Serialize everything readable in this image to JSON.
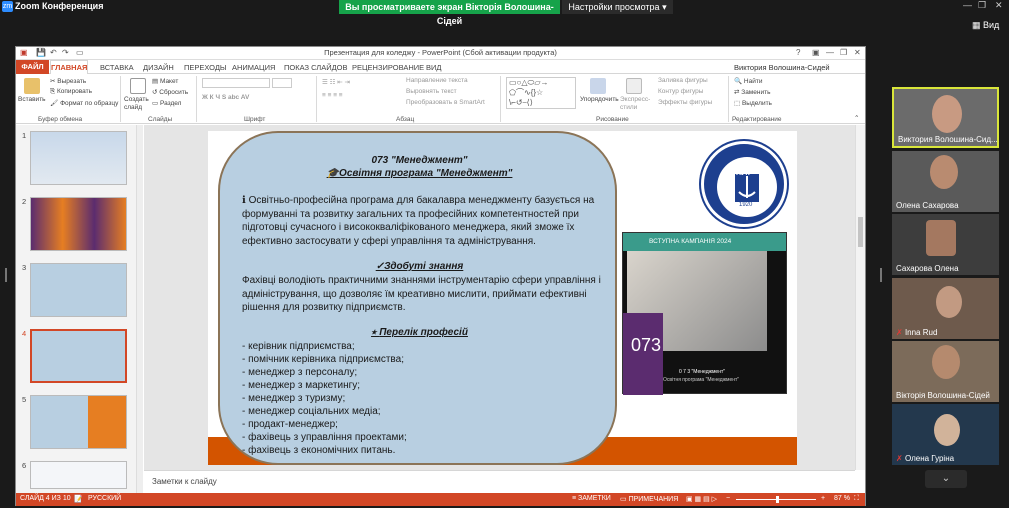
{
  "zoom": {
    "app_title": "Zoom Конференция",
    "share_banner": "Вы просматриваете экран Вікторія Волошина-Сідей",
    "view_options": "Настройки просмотра",
    "view_button": "Вид"
  },
  "ppt": {
    "window_title": "Презентация для коледжу - PowerPoint (Сбой активации продукта)",
    "user_name": "Виктория Волошина-Сидей",
    "tabs": [
      "ФАЙЛ",
      "ГЛАВНАЯ",
      "ВСТАВКА",
      "ДИЗАЙН",
      "ПЕРЕХОДЫ",
      "АНИМАЦИЯ",
      "ПОКАЗ СЛАЙДОВ",
      "РЕЦЕНЗИРОВАНИЕ",
      "ВИД"
    ],
    "ribbon": {
      "paste": "Вставить",
      "cut": "Вырезать",
      "copy": "Копировать",
      "format_painter": "Формат по образцу",
      "group_clipboard": "Буфер обмена",
      "new_slide": "Создать слайд",
      "layout": "Макет",
      "reset": "Сбросить",
      "section": "Раздел",
      "group_slides": "Слайды",
      "group_font": "Шрифт",
      "text_direction": "Направление текста",
      "align_text": "Выровнять текст",
      "smartart": "Преобразовать в SmartArt",
      "group_paragraph": "Абзац",
      "arrange": "Упорядочить",
      "quick_styles": "Экспресс-стили",
      "shape_fill": "Заливка фигуры",
      "shape_outline": "Контур фигуры",
      "shape_effects": "Эффекты фигуры",
      "group_drawing": "Рисование",
      "find": "Найти",
      "replace": "Заменить",
      "select": "Выделить",
      "group_editing": "Редактирование"
    },
    "thumbnails": [
      "1",
      "2",
      "3",
      "4",
      "5",
      "6"
    ],
    "notes_placeholder": "Заметки к слайду",
    "status": {
      "slide_info": "СЛАЙД 4 ИЗ 10",
      "language": "РУССКИЙ",
      "notes": "ЗАМЕТКИ",
      "comments": "ПРИМЕЧАНИЯ",
      "zoom": "87 %"
    }
  },
  "slide": {
    "title_line1": "073 \"Менеджмент\"",
    "title_line2": "Освітня програма \"Менеджмент\"",
    "intro": "Освітньо-професійна програма для бакалавра менеджменту базується на формуванні та розвитку загальних та професійних компетентностей при підготовці сучасного і висококваліфікованого менеджера, який зможе їх ефективно застосувати у сфері управління та адміністрування.",
    "skills_heading": "Здобуті знання",
    "skills_text": "Фахівці володіють практичними знаннями інструментарію сфери управління і адміністрування, що дозволяє їм креативно мислити, приймати ефективні рішення для розвитку підприємств.",
    "professions_heading": "Перелік професій",
    "professions": [
      "- керівник підприємства;",
      "- помічник керівника підприємства;",
      "- менеджер з персоналу;",
      "- менеджер з маркетингу;",
      "- менеджер з туризму;",
      "- менеджер соціальних медіа;",
      "- продакт-менеджер;",
      "- фахівець з управління проектами;",
      "- фахівець з економічних питань."
    ],
    "logo_abbr": "НУК",
    "logo_year": "1920",
    "poster_campaign": "ВСТУПНА КАМПАНІЯ 2024",
    "poster_number": "073",
    "poster_caption1": "0 7 3 \"Менеджмент\"",
    "poster_caption2": "Освітня програма \"Менеджмент\""
  },
  "participants": [
    "Виктория Волошина-Сид...",
    "Олена Сахарова",
    "Сахарова Олена",
    "Inna Rud",
    "Вікторія Волошина-Сідей",
    "Олена Гуріна"
  ]
}
